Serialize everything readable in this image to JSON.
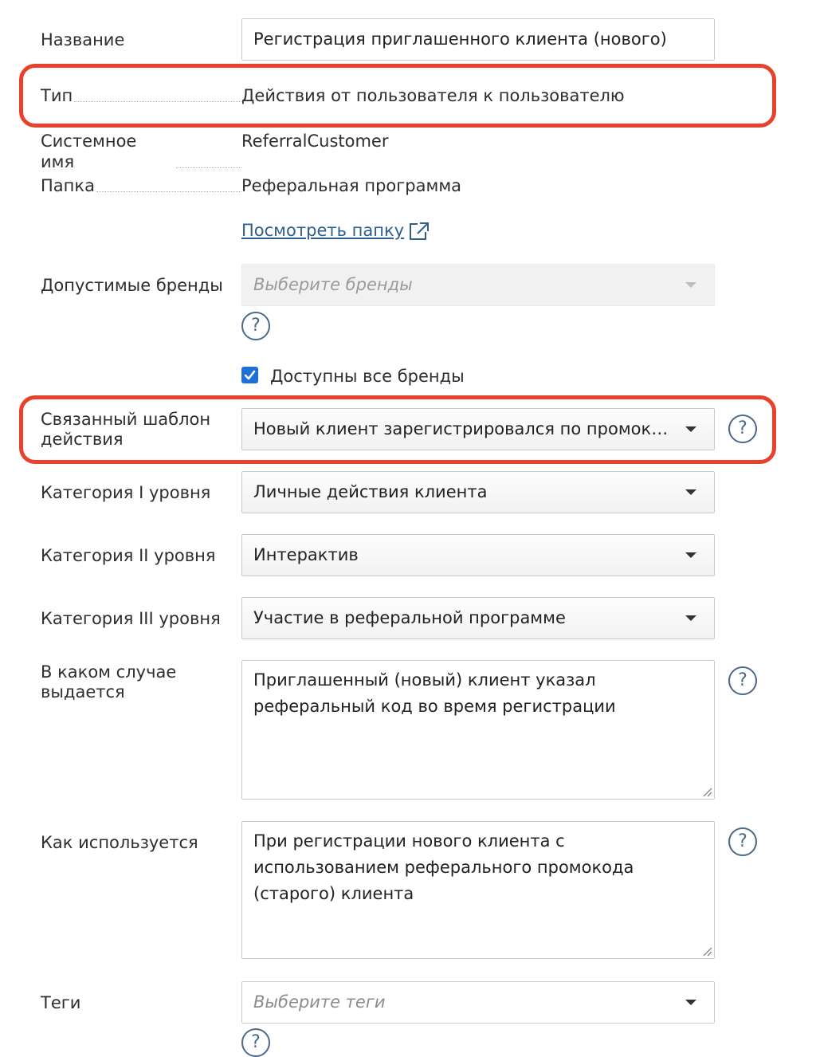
{
  "fields": {
    "name": {
      "label": "Название",
      "value": "Регистрация приглашенного клиента (нового)"
    },
    "type": {
      "label": "Тип",
      "value": "Действия от пользователя к пользователю"
    },
    "system_name": {
      "label": "Системное имя",
      "value": "ReferralCustomer"
    },
    "folder": {
      "label": "Папка",
      "value": "Реферальная программа",
      "link": "Посмотреть папку"
    },
    "brands": {
      "label": "Допустимые бренды",
      "placeholder": "Выберите бренды"
    },
    "all_brands": {
      "label": "Доступны все бренды",
      "checked": true
    },
    "template": {
      "label_line1": "Связанный шаблон",
      "label_line2": "действия",
      "value": "Новый клиент зарегистрировался по промоко..."
    },
    "category1": {
      "label": "Категория I уровня",
      "value": "Личные действия клиента"
    },
    "category2": {
      "label": "Категория II уровня",
      "value": "Интерактив"
    },
    "category3": {
      "label": "Категория III уровня",
      "value": "Участие в реферальной программе"
    },
    "when_issued": {
      "label_line1": "В каком случае",
      "label_line2": "выдается",
      "value": "Приглашенный (новый) клиент указал реферальный код во время регистрации"
    },
    "how_used": {
      "label": "Как используется",
      "value": "При регистрации нового клиента с использованием реферального промокода (старого) клиента"
    },
    "tags": {
      "label": "Теги",
      "placeholder": "Выберите теги"
    }
  },
  "help_glyph": "?",
  "colors": {
    "highlight": "#e8412c",
    "link": "#2d5f8f",
    "checkbox": "#1e6fd9",
    "help": "#4a6a8a"
  },
  "icons": [
    "external-link-icon",
    "help-icon",
    "chevron-down-icon",
    "check-icon",
    "resize-grip-icon"
  ]
}
